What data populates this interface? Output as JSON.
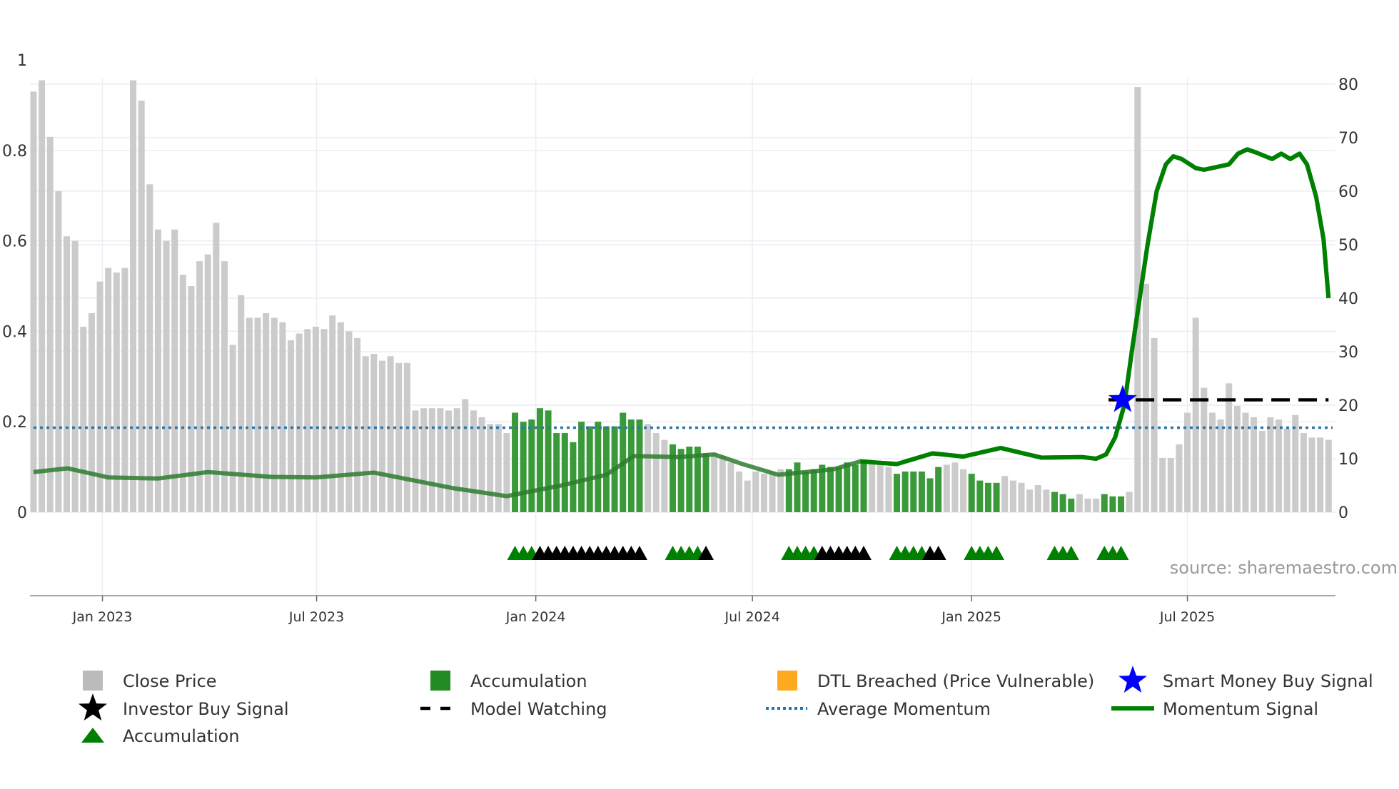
{
  "chart_data": {
    "type": "bar",
    "title": "",
    "x_unit": "week index",
    "left_axis": {
      "range": [
        0,
        1
      ],
      "ticks": [
        "0",
        "0.2",
        "0.4",
        "0.6",
        "0.8",
        "1"
      ],
      "tick_values": [
        0,
        0.2,
        0.4,
        0.6,
        0.8,
        1
      ]
    },
    "right_axis": {
      "range": [
        0,
        80
      ],
      "ticks": [
        "0",
        "10",
        "20",
        "30",
        "40",
        "50",
        "60",
        "70",
        "80"
      ],
      "tick_values": [
        0,
        10,
        20,
        30,
        40,
        50,
        60,
        70,
        80
      ]
    },
    "x_ticks": [
      {
        "label": "Jan 2023",
        "week": 8.3
      },
      {
        "label": "Jul 2023",
        "week": 34.1
      },
      {
        "label": "Jan 2024",
        "week": 60.5
      },
      {
        "label": "Jul 2024",
        "week": 86.6
      },
      {
        "label": "Jan 2025",
        "week": 113
      },
      {
        "label": "Jul 2025",
        "week": 139
      }
    ],
    "close_price": [
      0.93,
      0.955,
      0.83,
      0.71,
      0.61,
      0.6,
      0.41,
      0.44,
      0.51,
      0.54,
      0.53,
      0.54,
      0.955,
      0.91,
      0.725,
      0.625,
      0.6,
      0.625,
      0.525,
      0.5,
      0.555,
      0.57,
      0.64,
      0.555,
      0.37,
      0.48,
      0.43,
      0.43,
      0.44,
      0.43,
      0.42,
      0.38,
      0.395,
      0.405,
      0.41,
      0.405,
      0.435,
      0.42,
      0.4,
      0.385,
      0.345,
      0.35,
      0.335,
      0.345,
      0.33,
      0.33,
      0.225,
      0.23,
      0.23,
      0.23,
      0.225,
      0.23,
      0.25,
      0.225,
      0.21,
      0.195,
      0.195,
      0.175,
      0.22,
      0.2,
      0.205,
      0.23,
      0.225,
      0.175,
      0.175,
      0.155,
      0.2,
      0.19,
      0.2,
      0.19,
      0.19,
      0.22,
      0.205,
      0.205,
      0.195,
      0.175,
      0.16,
      0.15,
      0.14,
      0.145,
      0.145,
      0.13,
      0.13,
      0.125,
      0.11,
      0.09,
      0.07,
      0.09,
      0.085,
      0.09,
      0.095,
      0.095,
      0.11,
      0.09,
      0.095,
      0.105,
      0.1,
      0.1,
      0.11,
      0.105,
      0.115,
      0.11,
      0.105,
      0.1,
      0.085,
      0.09,
      0.09,
      0.09,
      0.075,
      0.1,
      0.105,
      0.11,
      0.095,
      0.085,
      0.07,
      0.065,
      0.065,
      0.08,
      0.07,
      0.065,
      0.05,
      0.06,
      0.05,
      0.045,
      0.04,
      0.03,
      0.04,
      0.03,
      0.03,
      0.04,
      0.035,
      0.035,
      0.045,
      0.94,
      0.505,
      0.385,
      0.12,
      0.12,
      0.15,
      0.22,
      0.43,
      0.275,
      0.22,
      0.205,
      0.285,
      0.235,
      0.22,
      0.21,
      0.18,
      0.21,
      0.205,
      0.185,
      0.215,
      0.175,
      0.165,
      0.165,
      0.16
    ],
    "accumulation_ranges": [
      [
        58,
        73
      ],
      [
        77,
        81
      ],
      [
        91,
        100
      ],
      [
        104,
        109
      ],
      [
        113,
        116
      ],
      [
        123,
        125
      ],
      [
        129,
        131
      ]
    ],
    "momentum_signal": [
      [
        0,
        7.5
      ],
      [
        4.1,
        8.2
      ],
      [
        9,
        6.5
      ],
      [
        15,
        6.3
      ],
      [
        21,
        7.5
      ],
      [
        28.7,
        6.6
      ],
      [
        34,
        6.5
      ],
      [
        41,
        7.4
      ],
      [
        50.5,
        4.5
      ],
      [
        57,
        3.0
      ],
      [
        63.6,
        5
      ],
      [
        69,
        7
      ],
      [
        72.3,
        10.5
      ],
      [
        77.8,
        10.3
      ],
      [
        82,
        10.8
      ],
      [
        85.4,
        9
      ],
      [
        89.7,
        7
      ],
      [
        96.3,
        8
      ],
      [
        99.6,
        9.5
      ],
      [
        104,
        9
      ],
      [
        108.3,
        11
      ],
      [
        112,
        10.4
      ],
      [
        116.5,
        12
      ],
      [
        121.4,
        10.2
      ],
      [
        126.3,
        10.3
      ],
      [
        128,
        10
      ],
      [
        129.2,
        10.8
      ],
      [
        130.3,
        14
      ],
      [
        131.4,
        20
      ],
      [
        132.3,
        30
      ],
      [
        134.2,
        50
      ],
      [
        135.3,
        60
      ],
      [
        136.4,
        65
      ],
      [
        137.3,
        66.5
      ],
      [
        138.3,
        66
      ],
      [
        140,
        64.3
      ],
      [
        141,
        64
      ],
      [
        144,
        65
      ],
      [
        145.1,
        67
      ],
      [
        146.2,
        67.8
      ],
      [
        147.3,
        67.2
      ],
      [
        149.2,
        66
      ],
      [
        150.3,
        67
      ],
      [
        151.4,
        66
      ],
      [
        152.5,
        67
      ],
      [
        153.4,
        65
      ],
      [
        154.5,
        59
      ],
      [
        155.4,
        51
      ],
      [
        156,
        40
      ]
    ],
    "momentum_solid_from_week": 100,
    "average_momentum": 15.8,
    "model_watching": {
      "from_week": 129.5,
      "to_week": 156,
      "value": 21
    },
    "smart_money_buy_signal": {
      "week": 131.2,
      "value": 21
    },
    "signal_triangles": {
      "accumulation": [
        58,
        59,
        60,
        77,
        78,
        79,
        80,
        91,
        92,
        93,
        94,
        104,
        105,
        106,
        107,
        113,
        114,
        115,
        116,
        123,
        124,
        125,
        129,
        130,
        131
      ],
      "investor_buy": [
        61,
        62,
        63,
        64,
        65,
        66,
        67,
        68,
        69,
        70,
        71,
        72,
        73,
        81,
        95,
        96,
        97,
        98,
        99,
        100,
        108,
        109
      ]
    },
    "legend": [
      {
        "label": "Close Price",
        "marker": "square",
        "color": "#bbbbbb"
      },
      {
        "label": "Accumulation",
        "marker": "square",
        "color": "#228b22"
      },
      {
        "label": "DTL Breached (Price Vulnerable)",
        "marker": "square",
        "color": "#ffa91f"
      },
      {
        "label": "Smart Money Buy Signal",
        "marker": "star",
        "color": "#0000ff"
      },
      {
        "label": "Investor Buy Signal",
        "marker": "star",
        "color": "#000000"
      },
      {
        "label": "Model Watching",
        "marker": "dash",
        "color": "#000000"
      },
      {
        "label": "Average Momentum",
        "marker": "dot",
        "color": "#1f77b4"
      },
      {
        "label": "Momentum Signal",
        "marker": "line",
        "color": "#008000"
      },
      {
        "label": "Accumulation",
        "marker": "triangle",
        "color": "#008000"
      }
    ],
    "legend_placement": "bottom"
  },
  "source": "source: sharemaestro.com"
}
